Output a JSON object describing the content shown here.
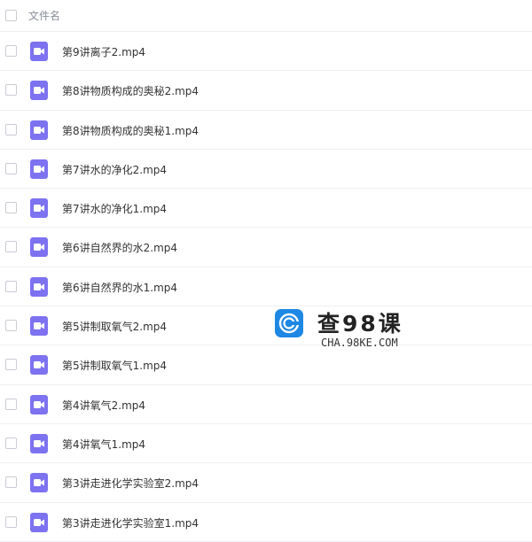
{
  "header": {
    "column_label": "文件名"
  },
  "files": [
    {
      "name": "第9讲离子2.mp4",
      "icon": "video-file-icon"
    },
    {
      "name": "第8讲物质构成的奥秘2.mp4",
      "icon": "video-file-icon"
    },
    {
      "name": "第8讲物质构成的奥秘1.mp4",
      "icon": "video-file-icon"
    },
    {
      "name": "第7讲水的净化2.mp4",
      "icon": "video-file-icon"
    },
    {
      "name": "第7讲水的净化1.mp4",
      "icon": "video-file-icon"
    },
    {
      "name": "第6讲自然界的水2.mp4",
      "icon": "video-file-icon"
    },
    {
      "name": "第6讲自然界的水1.mp4",
      "icon": "video-file-icon"
    },
    {
      "name": "第5讲制取氧气2.mp4",
      "icon": "video-file-icon"
    },
    {
      "name": "第5讲制取氧气1.mp4",
      "icon": "video-file-icon"
    },
    {
      "name": "第4讲氧气2.mp4",
      "icon": "video-file-icon"
    },
    {
      "name": "第4讲氧气1.mp4",
      "icon": "video-file-icon"
    },
    {
      "name": "第3讲走进化学实验室2.mp4",
      "icon": "video-file-icon"
    },
    {
      "name": "第3讲走进化学实验室1.mp4",
      "icon": "video-file-icon"
    }
  ],
  "watermark": {
    "title": "查98课",
    "url": "CHA.98KE.COM"
  },
  "colors": {
    "icon_bg": "#7d72f0",
    "logo_blue": "#1e88e5",
    "divider": "#eef0f4"
  }
}
